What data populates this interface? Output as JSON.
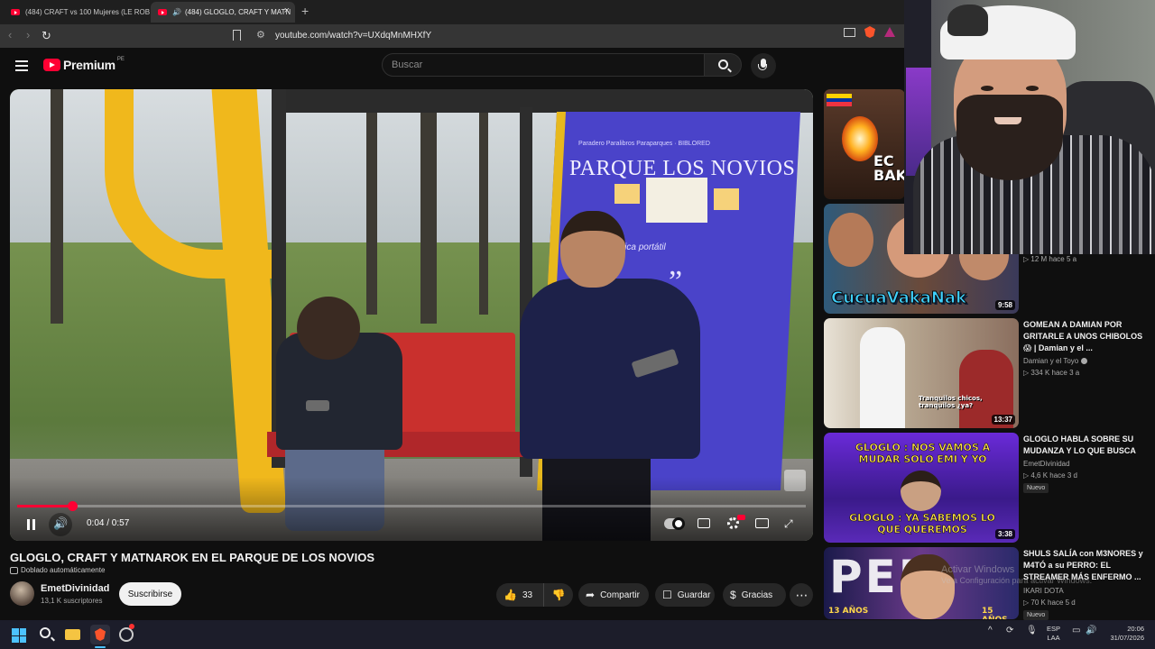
{
  "browser": {
    "tabs": [
      {
        "label": "(484) CRAFT vs 100 Mujeres (LE ROBO",
        "active": false
      },
      {
        "label": "(484) GLOGLO, CRAFT Y MATN",
        "active": true
      }
    ],
    "new_tab": "+",
    "url": "youtube.com/watch?v=UXdqMnMHXfY"
  },
  "youtube": {
    "logo_text": "Premium",
    "country_code": "PE",
    "search_placeholder": "Buscar"
  },
  "player": {
    "time": "0:04 / 0:57",
    "progress_fraction": 0.07,
    "poster_subtitle": "Paradero Paralibros Paraparques · BIBLORED",
    "poster_title": "PARQUE LOS NOVIOS",
    "poster_text": "magia única portátil"
  },
  "video": {
    "title": "GLOGLO, CRAFT Y MATNAROK EN EL PARQUE DE LOS NOVIOS",
    "dubbed": "Doblado automáticamente",
    "channel": "EmetDivinidad",
    "subscribers": "13,1 K suscriptores",
    "subscribe_label": "Suscribirse",
    "likes": "33",
    "share_label": "Compartir",
    "save_label": "Guardar",
    "thanks_label": "Gracias"
  },
  "recommendations": [
    {
      "thumb_text": "EC BAK",
      "meta": ""
    },
    {
      "thumb_text": "CucuaVakaNak",
      "duration": "9:58",
      "meta": "12 M   hace 5 a"
    },
    {
      "title": "GOMEAN A DAMIAN POR GRITARLE A UNOS CHIBOLOS 😱 | Damian y el ...",
      "channel": "Damian y el Toyo",
      "meta": "334 K   hace 3 a",
      "duration": "13:37",
      "thumb_text": "Tranquilos chicos, tranquilos ¿ya?"
    },
    {
      "title": "GLOGLO HABLA SOBRE SU MUDANZA Y LO QUE BUSCA",
      "channel": "EmetDivinidad",
      "meta": "4,6 K   hace 3 d",
      "badge": "Nuevo",
      "duration": "3:38",
      "thumb_text_top": "GLOGLO : NOS VAMOS A MUDAR SOLO EMI Y YO",
      "thumb_text_bottom": "GLOGLO : YA SABEMOS LO QUE QUEREMOS"
    },
    {
      "title": "SHULS SALÍA con M3NORES y M4TÓ a su PERRO: EL STREAMER MÁS ENFERMO ...",
      "channel": "IKARI DOTA",
      "meta": "70 K   hace 5 d",
      "badge": "Nuevo",
      "thumb_text": "PED",
      "age_left": "13 AÑOS",
      "age_right": "15 AÑOS"
    }
  ],
  "windows_watermark": {
    "line1": "Activar Windows",
    "line2": "Ve a Configuración para activar Windows."
  },
  "taskbar": {
    "language": "ESP",
    "layout": "LAA",
    "time": "20:06",
    "date": "31/07/2026"
  },
  "colors": {
    "accent": "#ff0033",
    "background": "#0f0f0f",
    "windows_blue": "#4cc2ff"
  }
}
